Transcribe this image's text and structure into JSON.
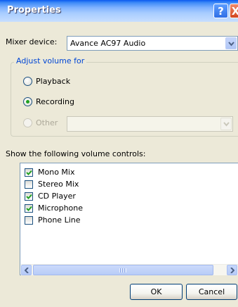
{
  "window": {
    "title": "Properties",
    "help_glyph": "?",
    "close_glyph": "X"
  },
  "mixer": {
    "label": "Mixer device:",
    "value": "Avance AC97 Audio"
  },
  "adjust_group": {
    "legend": "Adjust volume for",
    "options": [
      {
        "label": "Playback",
        "checked": false,
        "enabled": true
      },
      {
        "label": "Recording",
        "checked": true,
        "enabled": true
      },
      {
        "label": "Other",
        "checked": false,
        "enabled": false
      }
    ],
    "other_combo_value": ""
  },
  "controls": {
    "heading": "Show the following volume controls:",
    "items": [
      {
        "label": "Mono Mix",
        "checked": true
      },
      {
        "label": "Stereo Mix",
        "checked": false
      },
      {
        "label": "CD Player",
        "checked": true
      },
      {
        "label": "Microphone",
        "checked": true
      },
      {
        "label": "Phone Line",
        "checked": false
      }
    ]
  },
  "buttons": {
    "ok": "OK",
    "cancel": "Cancel"
  },
  "colors": {
    "dialog_bg": "#ECE9D8",
    "group_legend": "#0046D5",
    "check_mark": "#21A121"
  },
  "icons": [
    "help-icon",
    "close-icon",
    "chevron-down-icon",
    "check-icon",
    "arrow-left-icon",
    "arrow-right-icon"
  ]
}
